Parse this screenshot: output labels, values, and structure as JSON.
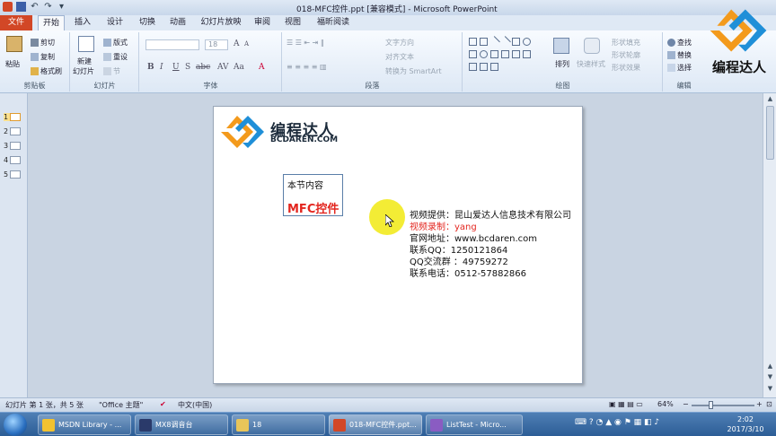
{
  "window": {
    "title": "018-MFC控件.ppt [兼容模式] - Microsoft PowerPoint"
  },
  "menu": {
    "file": "文件",
    "tabs": [
      "开始",
      "插入",
      "设计",
      "切换",
      "动画",
      "幻灯片放映",
      "审阅",
      "视图",
      "福昕阅读器"
    ]
  },
  "ribbon": {
    "clipboard": {
      "paste": "粘贴",
      "cut": "剪切",
      "copy": "复制",
      "format_painter": "格式刷",
      "label": "剪贴板"
    },
    "slides": {
      "new_slide_1": "新建",
      "new_slide_2": "幻灯片",
      "layout": "版式",
      "reset": "重设",
      "section": "节",
      "label": "幻灯片"
    },
    "font": {
      "font_size": "18",
      "label": "字体"
    },
    "paragraph": {
      "text_direction": "文字方向",
      "align_text": "对齐文本",
      "smartart": "转换为 SmartArt",
      "label": "段落"
    },
    "drawing": {
      "arrange": "排列",
      "quick_styles": "快速样式",
      "shape_fill": "形状填充",
      "shape_outline": "形状轮廓",
      "shape_effects": "形状效果",
      "label": "绘图"
    },
    "editing": {
      "find": "查找",
      "replace": "替换",
      "select": "选择",
      "label": "编辑"
    }
  },
  "thumbnails": [
    "1",
    "2",
    "3",
    "4",
    "5"
  ],
  "slide": {
    "logo_cn": "编程达人",
    "logo_en": "BCDAREN.COM",
    "contents_title": "本节内容",
    "contents_topic": "MFC控件",
    "info": {
      "provider": "视频提供：昆山爱达人信息技术有限公司",
      "recorder": "视频录制：yang",
      "website": "官网地址：www.bcdaren.com",
      "qq": "联系QQ：1250121864",
      "qq_group": "QQ交流群 ：49759272",
      "phone": "联系电话：0512-57882866"
    }
  },
  "statusbar": {
    "slide_info": "幻灯片 第 1 张，共 5 张",
    "theme": "\"Office 主题\"",
    "language": "中文(中国)",
    "zoom": "64%"
  },
  "taskbar": {
    "items": [
      "MSDN Library - ...",
      "MX8调音台",
      "18",
      "018-MFC控件.ppt...",
      "ListTest - Micro..."
    ],
    "time": "2:02",
    "date": "2017/3/10"
  },
  "brand": {
    "text": "编程达人"
  },
  "colors": {
    "accent_red": "#e3261f",
    "file_tab": "#d24726",
    "logo_orange": "#f39a1c",
    "logo_blue": "#1f8fd8"
  }
}
